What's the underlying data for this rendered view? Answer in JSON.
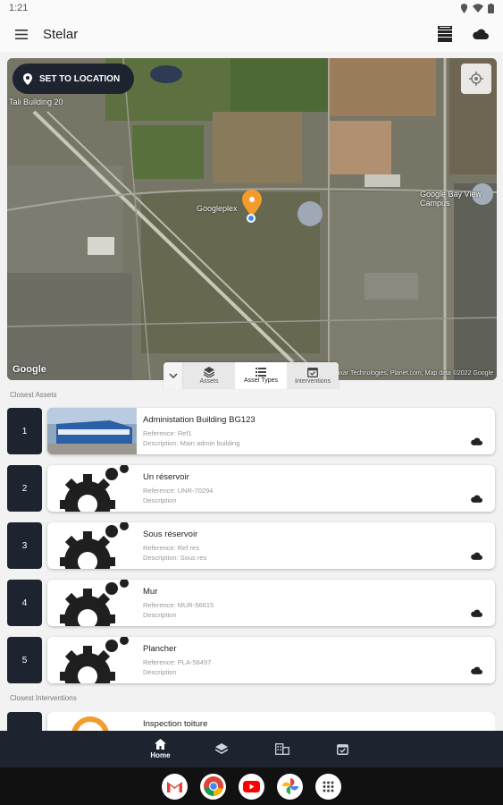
{
  "status_bar": {
    "time": "1:21"
  },
  "app_bar": {
    "title": "Stelar"
  },
  "map": {
    "set_location_label": "SET TO LOCATION",
    "labels": [
      "Googleplex",
      "Google Bay View Campus",
      "Tali Building 20"
    ],
    "logo": "Google",
    "attribution": "Imagery ©2022 USDA/Airbus, Maxar Technologies, Planet.com, Map data ©2022 Google"
  },
  "layer_toolbar": {
    "tabs": [
      {
        "label": "Assets",
        "icon": "layers-icon"
      },
      {
        "label": "Asset Types",
        "icon": "list-icon"
      },
      {
        "label": "Interventions",
        "icon": "calendar-check-icon"
      }
    ]
  },
  "closest_assets": {
    "heading": "Closest Assets",
    "items": [
      {
        "number": "1",
        "name": "Administation Building BG123",
        "reference": "Reference: Ref1",
        "description": "Description: Main admin building",
        "thumbnail": "building-photo"
      },
      {
        "number": "2",
        "name": "Un réservoir",
        "reference": "Reference: UNR-70294",
        "description": "Description",
        "thumbnail": "gear-icon"
      },
      {
        "number": "3",
        "name": "Sous réservoir",
        "reference": "Reference: Ref res",
        "description": "Description: Sous res",
        "thumbnail": "gear-icon"
      },
      {
        "number": "4",
        "name": "Mur",
        "reference": "Reference: MUR-56615",
        "description": "Description",
        "thumbnail": "gear-icon"
      },
      {
        "number": "5",
        "name": "Plancher",
        "reference": "Reference: PLA-58497",
        "description": "Description",
        "thumbnail": "gear-icon"
      }
    ]
  },
  "closest_interventions": {
    "heading": "Closest Interventions",
    "items": [
      {
        "name": "Inspection toiture"
      }
    ]
  },
  "bottom_nav": {
    "items": [
      {
        "label": "Home",
        "icon": "home-icon",
        "active": true
      },
      {
        "label": "",
        "icon": "layers-icon",
        "active": false
      },
      {
        "label": "",
        "icon": "buildings-icon",
        "active": false
      },
      {
        "label": "",
        "icon": "calendar-check-icon",
        "active": false
      }
    ]
  },
  "dock": {
    "apps": [
      "gmail-icon",
      "chrome-icon",
      "youtube-icon",
      "photos-icon",
      "app-drawer-icon"
    ]
  },
  "colors": {
    "primary_dark": "#1d2430",
    "marker_orange": "#f39c2c",
    "accent_blue": "#4285f4"
  }
}
